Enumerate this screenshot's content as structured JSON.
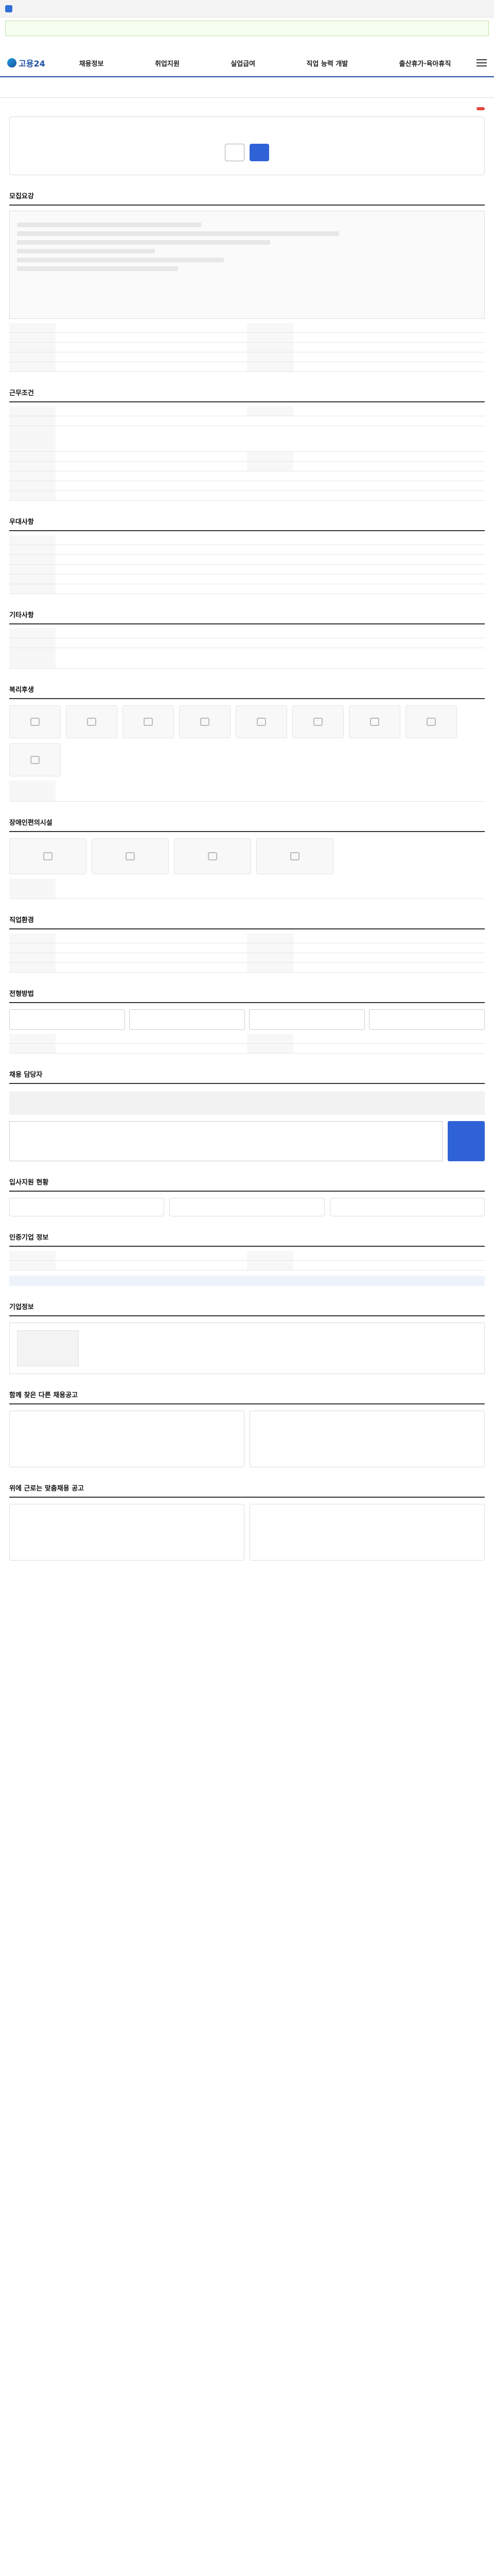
{
  "header": {
    "strip_text": "",
    "search_placeholder": "",
    "util_links": [
      "",
      "",
      ""
    ],
    "logo": "고용24",
    "menu": [
      "채용정보",
      "취업지원",
      "실업급여",
      "직업 능력 개발",
      "출산휴가·육아휴직"
    ]
  },
  "tabs": [
    "",
    "",
    "",
    "",
    "",
    "",
    ""
  ],
  "job": {
    "title": "",
    "badge": "",
    "summary_left_head": "",
    "summary_right_head": "",
    "summary_rows_left": [
      {
        "k": "",
        "v": ""
      },
      {
        "k": "",
        "v": ""
      },
      {
        "k": "",
        "v": ""
      },
      {
        "k": "",
        "v": ""
      }
    ],
    "summary_rows_right": [
      {
        "k": "",
        "v": ""
      },
      {
        "k": "",
        "v": ""
      },
      {
        "k": "",
        "v": ""
      },
      {
        "k": "",
        "v": ""
      }
    ],
    "save_button": "",
    "apply_button": "",
    "notice": ""
  },
  "sections": {
    "recruit": "모집요강",
    "conditions": "근무조건",
    "preference": "우대사항",
    "other": "기타사항",
    "welfare": "복리후생",
    "disabled": "장애인편의시설",
    "job_info": "직업환경",
    "process": "전형방법",
    "contact": "채용 담당자",
    "stats": "입사지원 현황",
    "recruit_info": "인증기업 정보",
    "company": "기업정보",
    "others": "함께 찾은 다른 채용공고",
    "recommend": "위에 근로는 맞춤채용 공고"
  },
  "more_label": "",
  "process_steps": [
    "",
    "",
    "",
    ""
  ],
  "contact_alert": "",
  "contact_text": "",
  "inquiry_placeholder": "",
  "inquiry_button": "",
  "stats": [
    {
      "label": "",
      "value": ""
    },
    {
      "label": "",
      "value": ""
    },
    {
      "label": "",
      "value": ""
    }
  ]
}
